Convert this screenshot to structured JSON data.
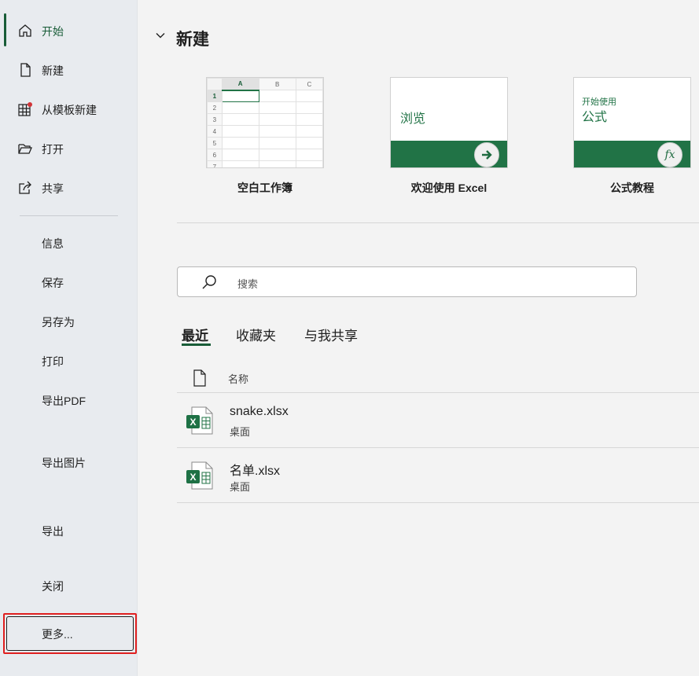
{
  "sidebar": {
    "items": [
      {
        "label": "开始",
        "icon": "home-icon"
      },
      {
        "label": "新建",
        "icon": "new-document-icon"
      },
      {
        "label": "从模板新建",
        "icon": "template-icon"
      },
      {
        "label": "打开",
        "icon": "folder-open-icon"
      },
      {
        "label": "共享",
        "icon": "share-icon"
      },
      {
        "label": "信息"
      },
      {
        "label": "保存"
      },
      {
        "label": "另存为"
      },
      {
        "label": "打印"
      },
      {
        "label": "导出PDF"
      },
      {
        "label": "导出图片"
      },
      {
        "label": "导出"
      },
      {
        "label": "关闭"
      },
      {
        "label": "更多..."
      }
    ]
  },
  "main": {
    "section_title": "新建",
    "templates": [
      {
        "name": "空白工作簿",
        "columns": [
          "A",
          "B",
          "C"
        ],
        "rows": [
          "1",
          "2",
          "3",
          "4",
          "5",
          "6",
          "7"
        ]
      },
      {
        "name": "欢迎使用 Excel",
        "thumb_text": "浏览"
      },
      {
        "name": "公式教程",
        "thumb_small": "开始使用",
        "thumb_text": "公式",
        "badge": "fx"
      }
    ],
    "search": {
      "placeholder": "搜索"
    },
    "tabs": [
      "最近",
      "收藏夹",
      "与我共享"
    ],
    "list": {
      "column_name": "名称",
      "files": [
        {
          "name": "snake.xlsx",
          "location": "桌面"
        },
        {
          "name": "名单.xlsx",
          "location": "桌面"
        }
      ]
    }
  },
  "colors": {
    "accent": "#185c37",
    "excel_green": "#217346",
    "highlight_border": "#e02020"
  }
}
